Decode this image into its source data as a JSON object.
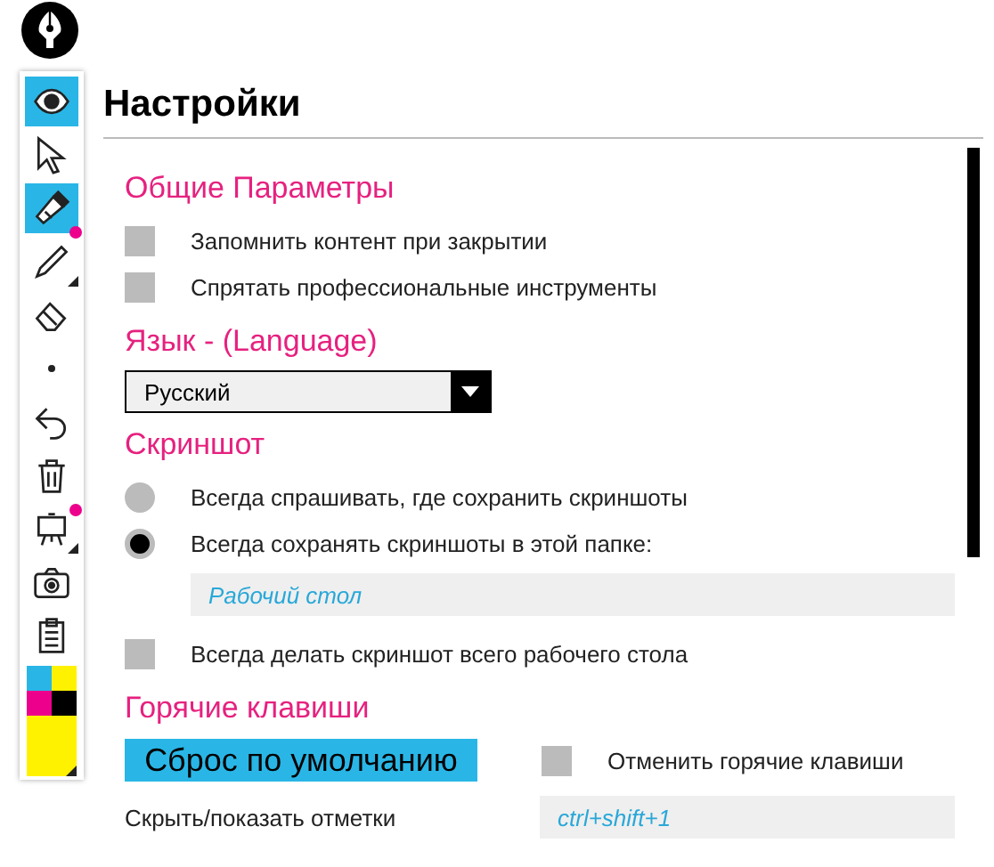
{
  "toolbar": {
    "tools": [
      {
        "kind": "eye",
        "selected": true,
        "dot": false,
        "submenu": false
      },
      {
        "kind": "cursor",
        "selected": false,
        "dot": false,
        "submenu": false
      },
      {
        "kind": "highlighter",
        "selected": true,
        "dot": true,
        "submenu": false
      },
      {
        "kind": "pen",
        "selected": false,
        "dot": false,
        "submenu": true
      },
      {
        "kind": "eraser",
        "selected": false,
        "dot": false,
        "submenu": false
      },
      {
        "kind": "size",
        "selected": false,
        "dot": false,
        "submenu": false
      },
      {
        "kind": "undo",
        "selected": false,
        "dot": false,
        "submenu": false
      },
      {
        "kind": "trash",
        "selected": false,
        "dot": false,
        "submenu": false
      },
      {
        "kind": "board",
        "selected": false,
        "dot": true,
        "submenu": true
      },
      {
        "kind": "camera",
        "selected": false,
        "dot": false,
        "submenu": false
      },
      {
        "kind": "clipboard",
        "selected": false,
        "dot": false,
        "submenu": false
      }
    ],
    "colors": [
      {
        "color": "#29b6e6"
      },
      {
        "color": "#fff200"
      },
      {
        "color": "#ec008c"
      },
      {
        "color": "#000000"
      }
    ],
    "current_color": {
      "color": "#fff200"
    }
  },
  "settings": {
    "title": "Настройки",
    "general": {
      "heading": "Общие Параметры",
      "options": [
        {
          "label": "Запомнить контент при закрытии",
          "checked": false
        },
        {
          "label": "Спрятать профессиональные инструменты",
          "checked": false
        }
      ]
    },
    "language": {
      "heading": "Язык - (Language)",
      "value": "Русский"
    },
    "screenshot": {
      "heading": "Скриншот",
      "choices": [
        {
          "label": "Всегда спрашивать, где сохранить скриншоты",
          "selected": false
        },
        {
          "label": "Всегда сохранять скриншоты в этой папке:",
          "selected": true
        }
      ],
      "folder": "Рабочий стол",
      "full_desktop": {
        "label": "Всегда делать скриншот всего рабочего стола",
        "checked": false
      }
    },
    "hotkeys": {
      "heading": "Горячие клавиши",
      "reset_button": "Сброс по умолчанию",
      "disable": {
        "label": "Отменить горячие клавиши",
        "checked": false
      },
      "shortcuts": [
        {
          "label": "Скрыть/показать отметки",
          "value": "ctrl+shift+1"
        }
      ]
    }
  }
}
